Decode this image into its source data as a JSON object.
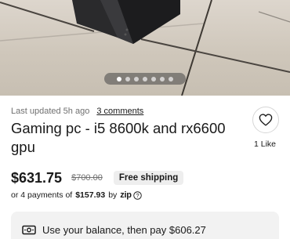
{
  "listing": {
    "updated": "Last updated 5h ago",
    "comments_link": "3 comments",
    "title": "Gaming pc - i5 8600k and rx6600 gpu",
    "likes": "1 Like"
  },
  "gallery": {
    "image_count": 7,
    "active_index": 0
  },
  "pricing": {
    "price": "$631.75",
    "original_price": "$700.00",
    "shipping_badge": "Free shipping",
    "installments_prefix": "or 4 payments of",
    "installment_amount": "$157.93",
    "installments_by": "by",
    "provider": "zip"
  },
  "balance": {
    "text": "Use your balance, then pay $606.27",
    "icon": "cash-icon"
  },
  "icons": {
    "like": "heart-icon",
    "info": "info-icon"
  }
}
